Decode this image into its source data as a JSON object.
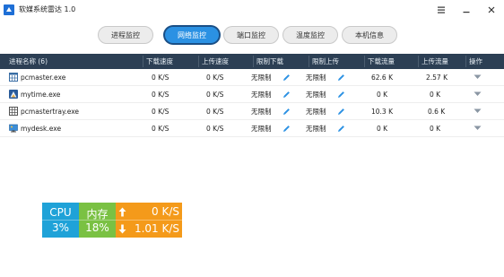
{
  "app": {
    "title": "软媒系统雷达 1.0",
    "accent_color": "#2b91e3",
    "header_bg": "#2c3f54",
    "window_buttons": [
      "menu-icon",
      "minimize-icon",
      "close-icon"
    ]
  },
  "tabs": [
    {
      "label": "进程监控",
      "active": false
    },
    {
      "label": "网络监控",
      "active": true
    },
    {
      "label": "端口监控",
      "active": false
    },
    {
      "label": "温度监控",
      "active": false
    },
    {
      "label": "本机信息",
      "active": false
    }
  ],
  "table": {
    "headers": {
      "name": "进程名称 (6)",
      "download_speed": "下载速度",
      "upload_speed": "上传速度",
      "limit_download": "限制下载",
      "limit_upload": "限制上传",
      "download_traffic": "下载流量",
      "upload_traffic": "上传流量",
      "actions": "操作"
    },
    "rows": [
      {
        "icon": "window-grid-icon",
        "name": "pcmaster.exe",
        "download_speed": "0 K/S",
        "upload_speed": "0 K/S",
        "limit_download": "无限制",
        "limit_upload": "无限制",
        "download_traffic": "62.6 K",
        "upload_traffic": "2.57 K"
      },
      {
        "icon": "app-icon",
        "name": "mytime.exe",
        "download_speed": "0 K/S",
        "upload_speed": "0 K/S",
        "limit_download": "无限制",
        "limit_upload": "无限制",
        "download_traffic": "0 K",
        "upload_traffic": "0 K"
      },
      {
        "icon": "window-grid-icon",
        "name": "pcmastertray.exe",
        "download_speed": "0 K/S",
        "upload_speed": "0 K/S",
        "limit_download": "无限制",
        "limit_upload": "无限制",
        "download_traffic": "10.3 K",
        "upload_traffic": "0.6 K"
      },
      {
        "icon": "desktop-icon",
        "name": "mydesk.exe",
        "download_speed": "0 K/S",
        "upload_speed": "0 K/S",
        "limit_download": "无限制",
        "limit_upload": "无限制",
        "download_traffic": "0 K",
        "upload_traffic": "0 K"
      }
    ]
  },
  "widget": {
    "cpu_label": "CPU",
    "cpu_value": "3%",
    "mem_label": "内存",
    "mem_value": "18%",
    "upload": "0 K/S",
    "download": "1.01 K/S",
    "colors": {
      "cpu": "#1fa2d8",
      "mem": "#7ac143",
      "net": "#f49a1a"
    }
  }
}
